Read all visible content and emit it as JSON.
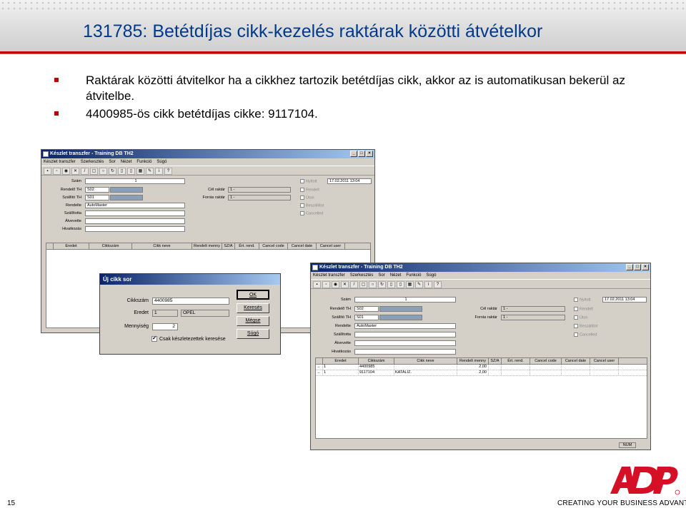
{
  "slide": {
    "title": "131785: Betétdíjas cikk-kezelés raktárak közötti átvételkor",
    "bullets": [
      "Raktárak közötti átvitelkor ha a cikkhez tartozik betétdíjas cikk, akkor az is automatikusan bekerül az átvitelbe.",
      "4400985-ös cikk betétdíjas cikke: 9117104."
    ],
    "page_number": "15",
    "tagline": "CREATING YOUR BUSINESS ADVANTAGE",
    "logo_text": "ADP",
    "colors": {
      "title": "#003a8c",
      "accent": "#c00000"
    }
  },
  "window1": {
    "title": "Készlet transzfer - Training DB TH2",
    "menu": [
      "Készlet transzfer",
      "Szerkesztés",
      "Sor",
      "Nézet",
      "Funkció",
      "Súgó"
    ],
    "labels": [
      "Szám",
      "Rendelő TH",
      "Szállító TH",
      "Rendelte",
      "Szállította",
      "Átvevette",
      "Hivatkozás"
    ],
    "values": {
      "szam": "1",
      "rendelo": "S02",
      "szallito": "S01",
      "rendelte": "AutoMaster"
    },
    "cel_raktar_label": "Cél raktár",
    "forras_raktar_label": "Forrás raktár",
    "raktar_value": "1 -",
    "checkboxes": [
      "Nyitott",
      "Rendelt",
      "Úton",
      "Beszállítot",
      "Cancelled"
    ],
    "date": "17.02.2011 13:04",
    "columns": [
      "Eredet",
      "Cikkszám",
      "Cikk neve",
      "Rendelt menny",
      "SZ/A",
      "Ért. rend.",
      "Cancel code",
      "Cancel date",
      "Cancel user"
    ]
  },
  "window2": {
    "title": "Készlet transzfer - Training DB TH2",
    "menu": [
      "Készlet transzfer",
      "Szerkesztés",
      "Sor",
      "Nézet",
      "Funkció",
      "Súgó"
    ],
    "labels": [
      "Szám",
      "Rendelő TH",
      "Szállító TH",
      "Rendelte",
      "Szállította",
      "Átvevette",
      "Hivatkozás"
    ],
    "values": {
      "szam": "1",
      "rendelo": "S02",
      "szallito": "S01",
      "rendelte": "AutoMaster"
    },
    "cel_raktar_label": "Cél raktár",
    "forras_raktar_label": "Forrás raktár",
    "raktar_value": "1 -",
    "checkboxes": [
      "Nyitott",
      "Rendelt",
      "Úton",
      "Beszállítot",
      "Cancelled"
    ],
    "date": "17.02.2011 13:04",
    "columns": [
      "Eredet",
      "Cikkszám",
      "Cikk neve",
      "Rendelt menny",
      "SZ/A",
      "Ért. rend.",
      "Cancel code",
      "Cancel date",
      "Cancel user"
    ],
    "rows": [
      {
        "eredet": "1",
        "cikkszam": "4400985",
        "cikk_neve": "",
        "menny": "2,00"
      },
      {
        "eredet": "1",
        "cikkszam": "9117104",
        "cikk_neve": "KATALIZ.",
        "menny": "2,00"
      }
    ],
    "status": "NUM"
  },
  "dialog": {
    "title": "Új cikk sor",
    "cikkszam_label": "Cikkszám",
    "cikkszam_value": "4400985",
    "eredet_label": "Eredet",
    "eredet_value": "1",
    "eredet_name": "OPEL",
    "mennyiseg_label": "Mennyiség",
    "mennyiseg_value": "2",
    "buttons": [
      "OK",
      "Keresés",
      "Mégse",
      "Súgó"
    ],
    "checkbox_label": "Csak készletezettek keresése"
  }
}
